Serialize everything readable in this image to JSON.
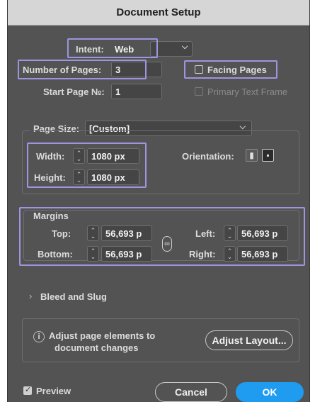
{
  "window": {
    "title": "Document Setup"
  },
  "intent": {
    "label": "Intent:",
    "value": "Web"
  },
  "pages": {
    "label": "Number of Pages:",
    "value": "3"
  },
  "start_page": {
    "label": "Start Page №:",
    "value": "1"
  },
  "facing_pages": {
    "label": "Facing Pages",
    "checked": false
  },
  "primary_text_frame": {
    "label": "Primary Text Frame",
    "checked": false,
    "enabled": false
  },
  "page_size": {
    "label": "Page Size:",
    "value": "[Custom]"
  },
  "width": {
    "label": "Width:",
    "value": "1080 px"
  },
  "height": {
    "label": "Height:",
    "value": "1080 px"
  },
  "orientation": {
    "label": "Orientation:",
    "selected": "landscape"
  },
  "margins": {
    "title": "Margins",
    "top": {
      "label": "Top:",
      "value": "56,693 p"
    },
    "bottom": {
      "label": "Bottom:",
      "value": "56,693 p"
    },
    "left": {
      "label": "Left:",
      "value": "56,693 p"
    },
    "right": {
      "label": "Right:",
      "value": "56,693 p"
    }
  },
  "bleed": {
    "label": "Bleed and Slug"
  },
  "adjust": {
    "text_line1": "Adjust page elements to",
    "text_line2": "document changes",
    "button": "Adjust Layout..."
  },
  "preview": {
    "label": "Preview",
    "checked": true
  },
  "footer": {
    "cancel": "Cancel",
    "ok": "OK"
  },
  "colors": {
    "highlight": "#9d95df",
    "accent": "#1f9bf0",
    "panel": "#535353"
  }
}
